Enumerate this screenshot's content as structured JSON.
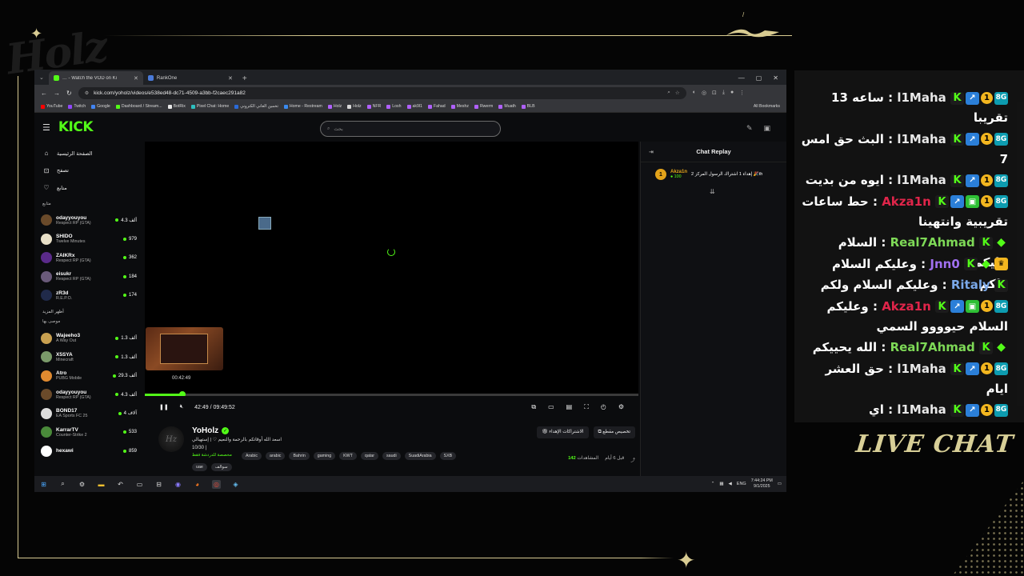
{
  "overlay": {
    "logo_text": "Holz",
    "live_chat_label": "LIVE CHAT",
    "colors": {
      "gold": "#d8cb91",
      "kick_green": "#53fc18"
    }
  },
  "browser": {
    "tabs": [
      {
        "label": "… - Watch the VOD on Ki",
        "icon": "kick-favicon",
        "active": true
      },
      {
        "label": "RankOne",
        "icon": "rankone-favicon",
        "active": false
      }
    ],
    "url": "kick.com/yoholz/videos/e538ed48-dc71-4509-a3bb-f2caec291a82",
    "bookmarks": [
      "YouTube",
      "Twitch",
      "Google",
      "Dashboard / Stream...",
      "BotRix",
      "Pixel Chat: Home",
      "تخمين الغاني الكتروني",
      "Home - Restream",
      "Holz",
      "Holz",
      "NFR",
      "Losh",
      "ak9l1",
      "Fahad",
      "Meshz",
      "Rwerm",
      "Muath",
      "BLB"
    ],
    "all_bookmarks": "All Bookmarks"
  },
  "kick": {
    "logo": "KICK",
    "search_placeholder": "بحث",
    "nav": [
      {
        "label": "الصفحة الرئيسية",
        "icon": "home-icon"
      },
      {
        "label": "تصفح",
        "icon": "browse-icon"
      },
      {
        "label": "متابع",
        "icon": "heart-icon"
      }
    ],
    "following_title": "متابع",
    "following": [
      {
        "name": "odayyouyou",
        "category": "Respect RP (GTA)",
        "viewers": "4.3 ألف",
        "color": "#6a4a2a"
      },
      {
        "name": "SHIDO",
        "category": "Twelve Minutes",
        "viewers": "979",
        "color": "#e8e0c8"
      },
      {
        "name": "ZAIKRx",
        "category": "Respect RP (GTA)",
        "viewers": "362",
        "color": "#5a2a8a"
      },
      {
        "name": "eisukr",
        "category": "Respect RP (GTA)",
        "viewers": "184",
        "color": "#6a5a7a"
      },
      {
        "name": "zR3d",
        "category": "R.E.P.O.",
        "viewers": "174",
        "color": "#202a4a"
      }
    ],
    "show_more": "أظهر المزيد",
    "recommended_title": "موصى بها",
    "recommended": [
      {
        "name": "Wajeeho3",
        "category": "A Way Out",
        "viewers": "1.3 ألف",
        "color": "#c8a050"
      },
      {
        "name": "X5SYA",
        "category": "Minecraft",
        "viewers": "1.3 ألف",
        "color": "#7a9a6a"
      },
      {
        "name": "Atro",
        "category": "PUBG Mobile",
        "viewers": "29.3 ألف",
        "color": "#e08a30"
      },
      {
        "name": "odayyouyou",
        "category": "Respect RP (GTA)",
        "viewers": "4.3 ألف",
        "color": "#6a4a2a"
      },
      {
        "name": "BOND17",
        "category": "EA Sports FC 25",
        "viewers": "4 آلاف",
        "color": "#dddddd"
      },
      {
        "name": "KarrarTV",
        "category": "Counter-Strike 2",
        "viewers": "533",
        "color": "#4a8a3a"
      },
      {
        "name": "hexawi",
        "category": "",
        "viewers": "859",
        "color": "#ffffff"
      }
    ],
    "player": {
      "preview_time": "00:42:49",
      "time": "42:49 / 09:49:52",
      "progress_fraction": 0.076
    },
    "stream": {
      "streamer": "YoHolz",
      "title": "اسعد الله أوقاتكم بالرحمة والنعيم ♡ | إستهبالي",
      "number": "10/30 |",
      "subtitle": "مخصصة للدردشة فقط",
      "tags": [
        "Arabic",
        "arabic",
        "Bahrin",
        "gaming",
        "KWT",
        "qatar",
        "saudi",
        "SuadiArabia",
        "SXB"
      ],
      "tags2": [
        "uae",
        "سوالف"
      ],
      "customize_button": "تخصيص مقطع",
      "gift_button": "الاشتراكات الإهداء",
      "ago": "قبل 6 أيام",
      "views_label": "المشاهدات",
      "views": "142"
    },
    "chat_replay": {
      "title": "Chat Replay",
      "pinned_user": "Akza1n",
      "pinned_amount": "100",
      "pinned_badge": "1",
      "pinned_text": "إهداء 1 اشتراك الرسول المركز 2 🎉th"
    }
  },
  "taskbar": {
    "lang": "ENG",
    "time": "7:44:24 PM",
    "date": "9/1/2025"
  },
  "livechat": {
    "messages": [
      {
        "user": "l1Maha",
        "user_color": "#e8e8e8",
        "text": "ساعه 13 تقريبا",
        "badges": [
          "k",
          "b",
          "n",
          "c"
        ]
      },
      {
        "user": "l1Maha",
        "user_color": "#e8e8e8",
        "text": "البث حق امس 7",
        "badges": [
          "k",
          "b",
          "n",
          "c"
        ]
      },
      {
        "user": "l1Maha",
        "user_color": "#e8e8e8",
        "text": "ايوه من بديت",
        "badges": [
          "k",
          "b",
          "n",
          "c"
        ]
      },
      {
        "user": "Akza1n",
        "user_color": "#e0254a",
        "text": "حط ساعات تقريبية وانتهينا",
        "badges": [
          "k",
          "b",
          "g",
          "n",
          "c"
        ]
      },
      {
        "user": "Real7Ahmad",
        "user_color": "#7ed957",
        "text": "السلام عليكم",
        "badges": [
          "k",
          "d"
        ]
      },
      {
        "user": "Jnn0",
        "user_color": "#a070f0",
        "text": "وعليكم السلام ولكم",
        "badges": [
          "k",
          "d",
          "cr"
        ]
      },
      {
        "user": "Ritaly",
        "user_color": "#7aa8e8",
        "text": "وعليكم السلام ولكم",
        "badges": [
          "k"
        ]
      },
      {
        "user": "Akza1n",
        "user_color": "#e0254a",
        "text": "وعليكم السلام حيوووو السمي",
        "badges": [
          "k",
          "b",
          "g",
          "n",
          "c"
        ]
      },
      {
        "user": "Real7Ahmad",
        "user_color": "#7ed957",
        "text": "الله يحييكم",
        "badges": [
          "k",
          "d"
        ]
      },
      {
        "user": "l1Maha",
        "user_color": "#e8e8e8",
        "text": "حق العشر ايام",
        "badges": [
          "k",
          "b",
          "n",
          "c"
        ]
      },
      {
        "user": "l1Maha",
        "user_color": "#e8e8e8",
        "text": "اي",
        "badges": [
          "k",
          "b",
          "n",
          "c"
        ]
      }
    ]
  }
}
